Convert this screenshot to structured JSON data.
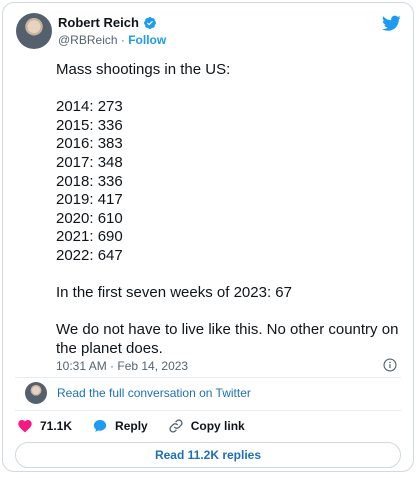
{
  "author": {
    "name": "Robert Reich",
    "handle": "@RBReich",
    "separator": " · ",
    "follow_label": "Follow"
  },
  "tweet": {
    "text": "Mass shootings in the US:\n\n2014: 273\n2015: 336\n2016: 383\n2017: 348\n2018: 336\n2019: 417\n2020: 610\n2021: 690\n2022: 647\n\nIn the first seven weeks of 2023: 67\n\nWe do not have to live like this. No other country on the planet does.",
    "timestamp": "10:31 AM · Feb 14, 2023"
  },
  "conversation_link": "Read the full conversation on Twitter",
  "actions": {
    "likes": "71.1K",
    "reply_label": "Reply",
    "copy_link_label": "Copy link"
  },
  "replies_button": "Read 11.2K replies",
  "colors": {
    "twitter_blue": "#1d9bf0",
    "like_pink": "#f91880",
    "link_blue": "#1d6fb8",
    "muted": "#536471",
    "border": "#cfd9de"
  },
  "icons": [
    "twitter-bird-icon",
    "verified-badge-icon",
    "info-icon",
    "heart-icon",
    "reply-bubble-icon",
    "link-icon"
  ]
}
